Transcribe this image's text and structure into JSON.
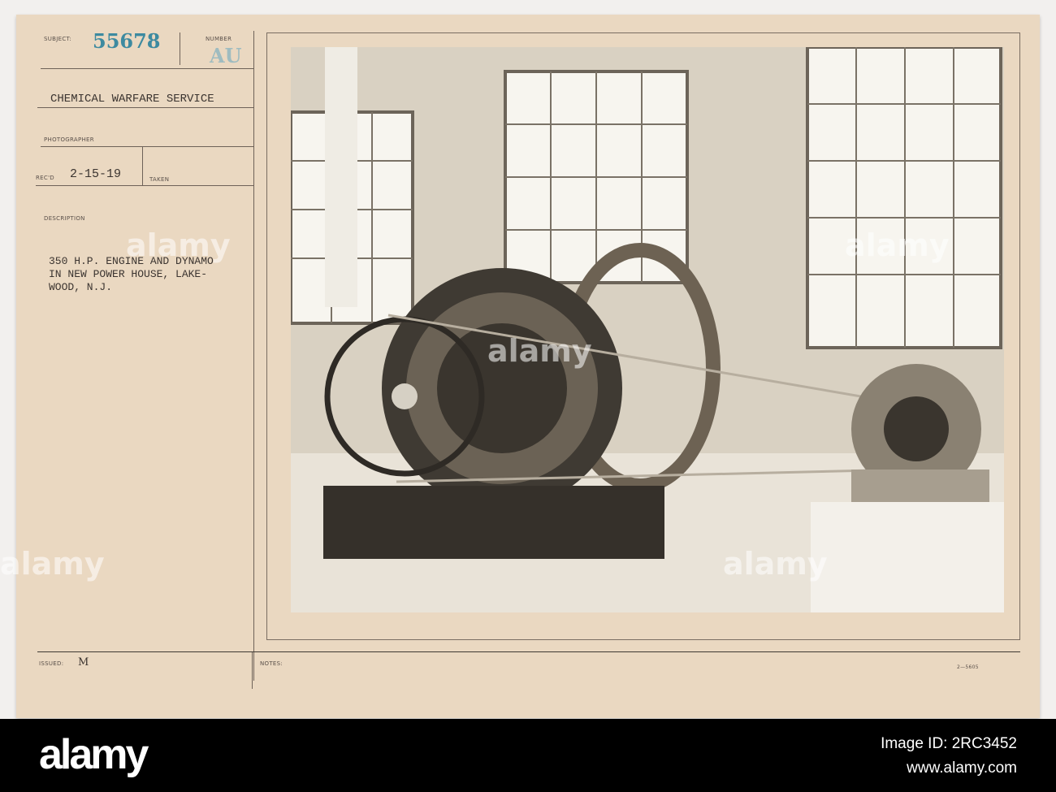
{
  "card": {
    "subject_label": "SUBJECT:",
    "subject": "55678",
    "number_label": "NUMBER",
    "number": "AU",
    "service": "CHEMICAL WARFARE SERVICE",
    "photographer_label": "PHOTOGRAPHER",
    "recd_label": "REC'D",
    "recd": "2-15-19",
    "taken_label": "TAKEN",
    "description_label": "DESCRIPTION",
    "description": [
      "350 H.P. ENGINE AND DYNAMO",
      "IN NEW POWER HOUSE, LAKE-",
      "WOOD, N.J."
    ],
    "issued_label": "ISSUED:",
    "issued": "M",
    "notes_label": "NOTES:",
    "form_code": "2—5605"
  },
  "footer": {
    "logo": "alamy",
    "image_id": "Image ID: 2RC3452",
    "url": "www.alamy.com"
  },
  "watermark": "alamy"
}
